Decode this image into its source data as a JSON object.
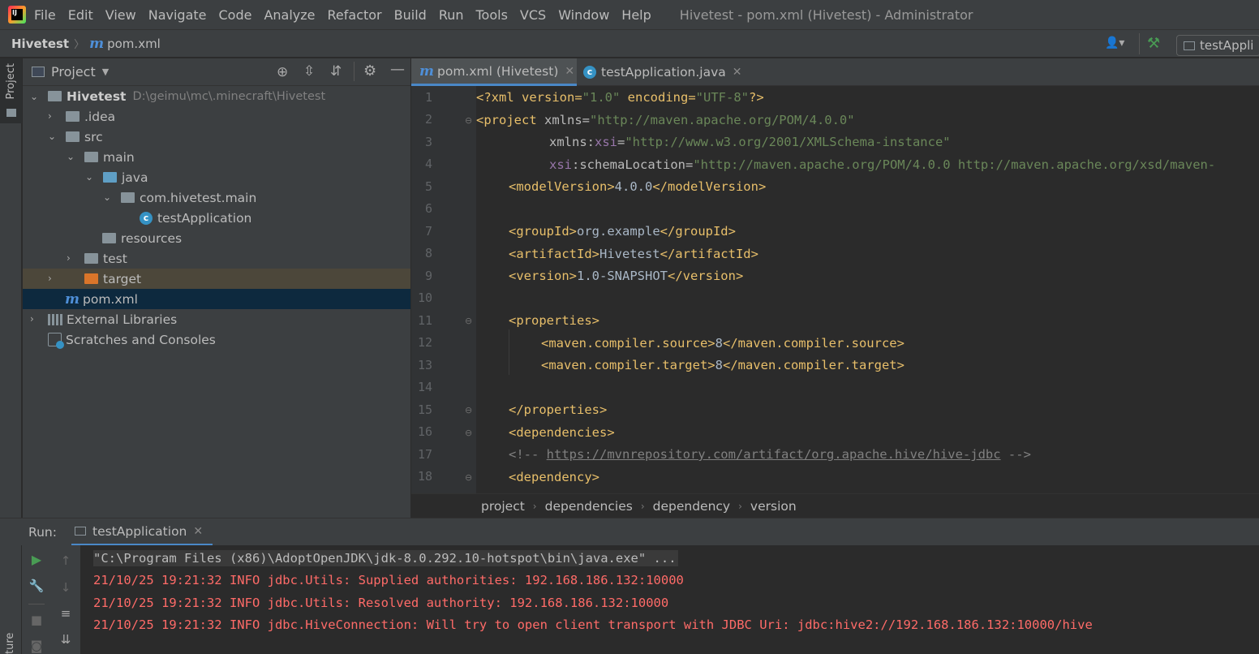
{
  "menubar": {
    "items": [
      "File",
      "Edit",
      "View",
      "Navigate",
      "Code",
      "Analyze",
      "Refactor",
      "Build",
      "Run",
      "Tools",
      "VCS",
      "Window",
      "Help"
    ],
    "window_title": "Hivetest - pom.xml (Hivetest) - Administrator"
  },
  "navbar": {
    "project": "Hivetest",
    "file": "pom.xml",
    "run_config": "testAppli"
  },
  "left_strip": {
    "project_tab": "Project",
    "structure_tab": "ture"
  },
  "project_panel": {
    "title": "Project",
    "tree": [
      {
        "label": "Hivetest",
        "path": "D:\\geimu\\mc\\.minecraft\\Hivetest"
      },
      {
        "label": ".idea"
      },
      {
        "label": "src"
      },
      {
        "label": "main"
      },
      {
        "label": "java"
      },
      {
        "label": "com.hivetest.main"
      },
      {
        "label": "testApplication"
      },
      {
        "label": "resources"
      },
      {
        "label": "test"
      },
      {
        "label": "target"
      },
      {
        "label": "pom.xml"
      },
      {
        "label": "External Libraries"
      },
      {
        "label": "Scratches and Consoles"
      }
    ]
  },
  "editor": {
    "tabs": [
      {
        "label": "pom.xml (Hivetest)",
        "active": true
      },
      {
        "label": "testApplication.java",
        "active": false
      }
    ],
    "line_numbers": [
      "1",
      "2",
      "3",
      "4",
      "5",
      "6",
      "7",
      "8",
      "9",
      "10",
      "11",
      "12",
      "13",
      "14",
      "15",
      "16",
      "17",
      "18"
    ],
    "breadcrumbs": [
      "project",
      "dependencies",
      "dependency",
      "version"
    ],
    "code": {
      "l1_a": "<?xml version=",
      "l1_b": "\"1.0\"",
      "l1_c": " encoding=",
      "l1_d": "\"UTF-8\"",
      "l1_e": "?>",
      "l2_a": "<project",
      "l2_b": " xmlns=",
      "l2_c": "\"http://maven.apache.org/POM/4.0.0\"",
      "l3_a": "xmlns:",
      "l3_b": "xsi",
      "l3_c": "=",
      "l3_d": "\"http://www.w3.org/2001/XMLSchema-instance\"",
      "l4_a": "xsi",
      "l4_b": ":schemaLocation=",
      "l4_c": "\"http://maven.apache.org/POM/4.0.0 http://maven.apache.org/xsd/maven-",
      "l5_a": "<modelVersion>",
      "l5_b": "4.0.0",
      "l5_c": "</modelVersion>",
      "l7_a": "<groupId>",
      "l7_b": "org.example",
      "l7_c": "</groupId>",
      "l8_a": "<artifactId>",
      "l8_b": "Hivetest",
      "l8_c": "</artifactId>",
      "l9_a": "<version>",
      "l9_b": "1.0-SNAPSHOT",
      "l9_c": "</version>",
      "l11": "<properties>",
      "l12_a": "<maven.compiler.source>",
      "l12_b": "8",
      "l12_c": "</maven.compiler.source>",
      "l13_a": "<maven.compiler.target>",
      "l13_b": "8",
      "l13_c": "</maven.compiler.target>",
      "l15": "</properties>",
      "l16": "<dependencies>",
      "l17_a": "<!-- ",
      "l17_b": "https://mvnrepository.com/artifact/org.apache.hive/hive-jdbc",
      "l17_c": " -->",
      "l18": "<dependency>"
    }
  },
  "run_panel": {
    "label": "Run:",
    "tab": "testApplication",
    "console_lines": [
      "\"C:\\Program Files (x86)\\AdoptOpenJDK\\jdk-8.0.292.10-hotspot\\bin\\java.exe\" ...",
      "21/10/25 19:21:32 INFO jdbc.Utils: Supplied authorities: 192.168.186.132:10000",
      "21/10/25 19:21:32 INFO jdbc.Utils: Resolved authority: 192.168.186.132:10000",
      "21/10/25 19:21:32 INFO jdbc.HiveConnection: Will try to open client transport with JDBC Uri: jdbc:hive2://192.168.186.132:10000/hive"
    ]
  },
  "colors": {
    "console_error": "#ff6b68",
    "console_cmd": "#bbbbbb",
    "selection": "#0d293e",
    "target_highlight": "#4c473a"
  }
}
